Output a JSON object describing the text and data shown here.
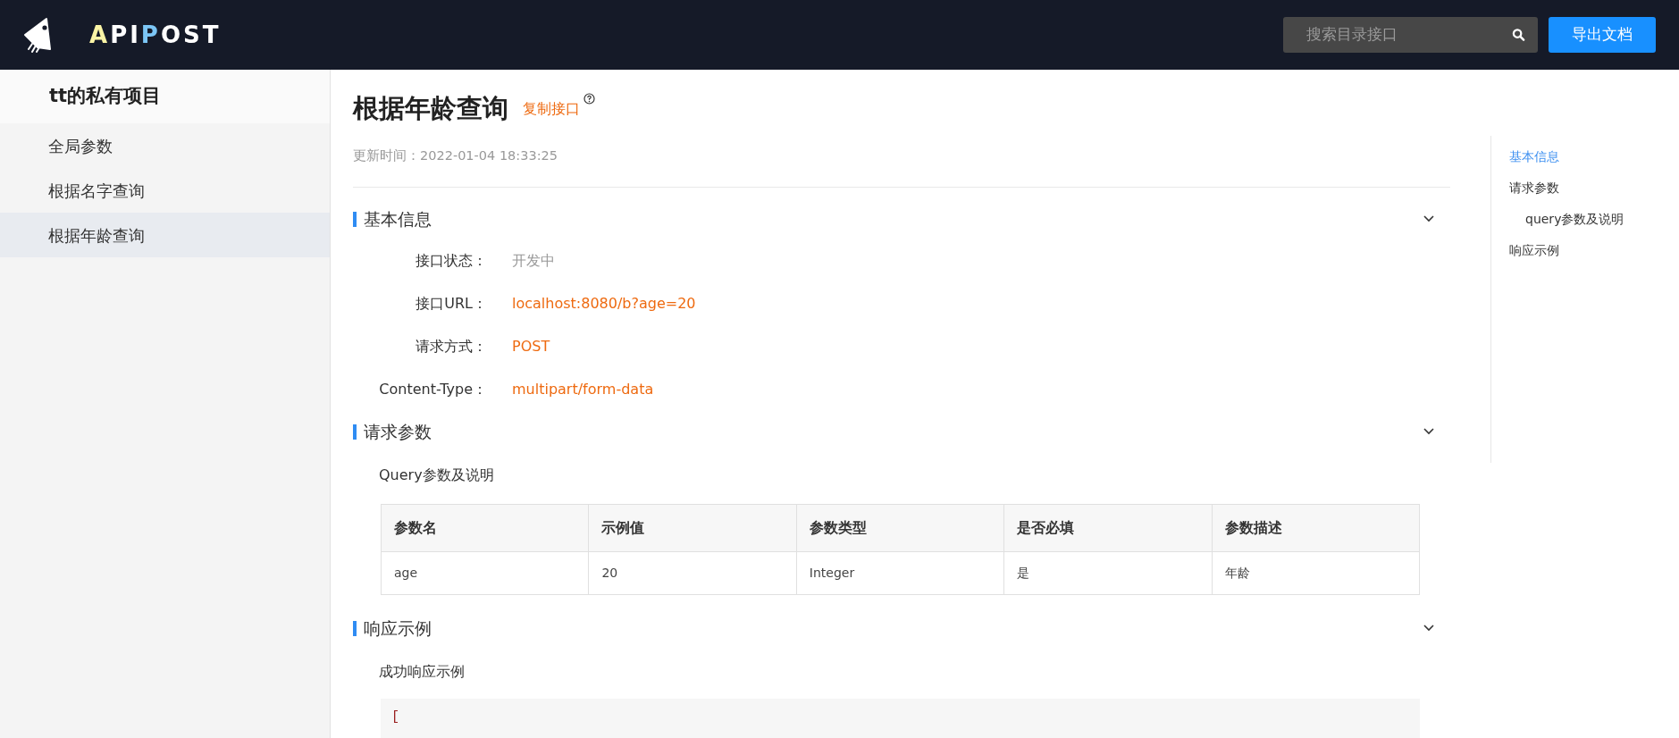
{
  "header": {
    "logo": [
      {
        "text": "A",
        "color": "#fbf5a6"
      },
      {
        "text": "PI",
        "color": "#ffffff"
      },
      {
        "text": "P",
        "color": "#7cc6f6"
      },
      {
        "text": "OST",
        "color": "#ffffff"
      }
    ],
    "search": {
      "placeholder": "搜索目录接口"
    },
    "export_button": "导出文档"
  },
  "sidebar": {
    "project_title": "tt的私有项目",
    "items": [
      {
        "label": "全局参数",
        "selected": false
      },
      {
        "label": "根据名字查询",
        "selected": false
      },
      {
        "label": "根据年龄查询",
        "selected": true
      }
    ]
  },
  "doc": {
    "title": "根据年龄查询",
    "copy_link": "复制接口",
    "updated": "更新时间：2022-01-04 18:33:25",
    "sections": [
      {
        "kind": "info",
        "title": "基本信息",
        "expanded": true,
        "fields": [
          {
            "label": "接口状态：",
            "value": "开发中",
            "kind": "status"
          },
          {
            "label": "接口URL：",
            "value": "localhost:8080/b?age=20",
            "kind": "link"
          },
          {
            "label": "请求方式：",
            "value": "POST",
            "kind": "link"
          },
          {
            "label": "Content-Type：",
            "value": "multipart/form-data",
            "kind": "link"
          }
        ]
      },
      {
        "kind": "table",
        "title": "请求参数",
        "expanded": true,
        "subtitle": "Query参数及说明",
        "table": {
          "columns": [
            "参数名",
            "示例值",
            "参数类型",
            "是否必填",
            "参数描述"
          ],
          "rows": [
            [
              "age",
              "20",
              "Integer",
              "是",
              "年龄"
            ]
          ]
        }
      },
      {
        "kind": "code",
        "title": "响应示例",
        "expanded": true,
        "subtitle": "成功响应示例",
        "code": "["
      }
    ]
  },
  "toc": [
    {
      "label": "基本信息",
      "selected": true
    },
    {
      "label": "请求参数",
      "selected": false,
      "children": [
        {
          "label": "query参数及说明",
          "selected": false
        }
      ]
    },
    {
      "label": "响应示例",
      "selected": false
    }
  ]
}
